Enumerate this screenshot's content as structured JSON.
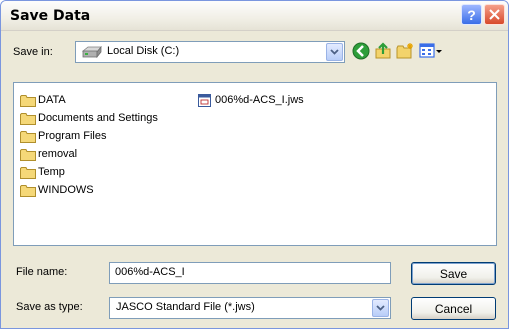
{
  "window": {
    "title": "Save Data"
  },
  "toolbar": {
    "save_in_label": "Save in:",
    "save_in_value": "Local Disk (C:)"
  },
  "files": {
    "folders": [
      "DATA",
      "Documents and Settings",
      "Program Files",
      "removal",
      "Temp",
      "WINDOWS"
    ],
    "documents": [
      "006%d-ACS_I.jws"
    ]
  },
  "form": {
    "file_name_label": "File name:",
    "file_name_value": "006%d-ACS_I",
    "save_type_label": "Save as type:",
    "save_type_value": "JASCO Standard File (*.jws)",
    "save_label": "Save",
    "cancel_label": "Cancel"
  },
  "icons": {
    "help": "help-icon",
    "close": "close-icon",
    "drive": "drive-icon",
    "back": "back-icon",
    "up": "up-folder-icon",
    "new_folder": "new-folder-icon",
    "views": "views-menu-icon",
    "folder": "folder-icon",
    "file": "document-icon"
  },
  "colors": {
    "title_bar": "#ece9d8",
    "accent_border": "#7f9db9",
    "close_red": "#d7492a",
    "help_blue": "#3a6ee8"
  }
}
